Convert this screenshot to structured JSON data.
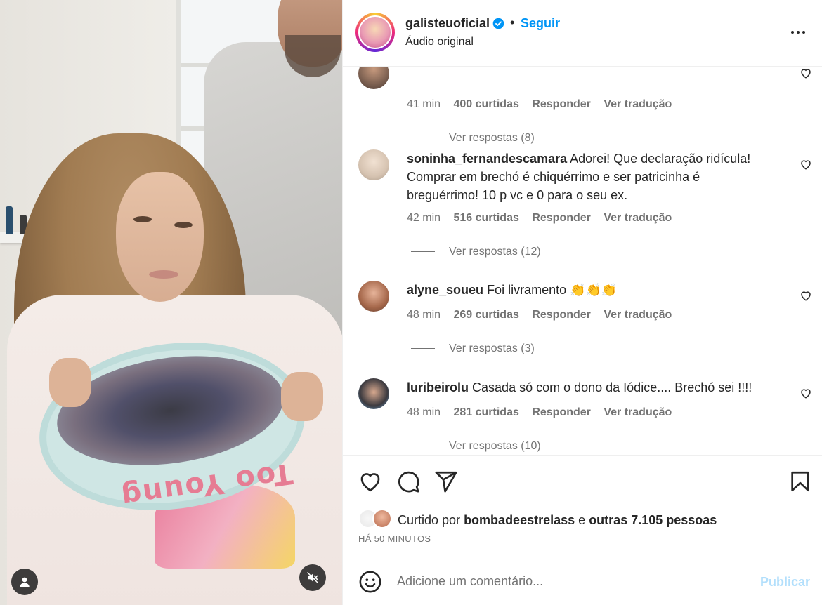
{
  "header": {
    "username": "galisteuoficial",
    "separator": "•",
    "follow_label": "Seguir",
    "audio_label": "Áudio original",
    "verified_icon": "verified-badge-icon",
    "more_icon": "more-options-icon"
  },
  "comments": [
    {
      "username": "",
      "text": "",
      "time": "41 min",
      "likes": "400 curtidas",
      "reply_label": "Responder",
      "translate_label": "Ver tradução",
      "view_replies": "Ver respostas (8)"
    },
    {
      "username": "soninha_fernandescamara",
      "text": "Adorei! Que declaração ridícula! Comprar em brechó é chiquérrimo e ser patricinha é breguérrimo! 10 p vc e 0 para o seu ex.",
      "time": "42 min",
      "likes": "516 curtidas",
      "reply_label": "Responder",
      "translate_label": "Ver tradução",
      "view_replies": "Ver respostas (12)"
    },
    {
      "username": "alyne_soueu",
      "text": "Foi livramento 👏👏👏",
      "time": "48 min",
      "likes": "269 curtidas",
      "reply_label": "Responder",
      "translate_label": "Ver tradução",
      "view_replies": "Ver respostas (3)"
    },
    {
      "username": "luribeirolu",
      "text": "Casada só com o dono da Iódice.... Brechó sei !!!!",
      "time": "48 min",
      "likes": "281 curtidas",
      "reply_label": "Responder",
      "translate_label": "Ver tradução",
      "view_replies": "Ver respostas (10)"
    }
  ],
  "likes": {
    "prefix": "Curtido por",
    "user": "bombadeestrelass",
    "conj": "e",
    "others": "outras 7.105 pessoas"
  },
  "posted_time": "HÁ 50 MINUTOS",
  "add_comment": {
    "placeholder": "Adicione um comentário...",
    "publish_label": "Publicar"
  },
  "media": {
    "tray_text": "Too Young",
    "profile_icon": "user-tag-icon",
    "mute_icon": "muted-speaker-icon"
  },
  "colors": {
    "accent": "#0095f6",
    "publish_disabled": "#b2dffc",
    "secondary_text": "#737373"
  }
}
